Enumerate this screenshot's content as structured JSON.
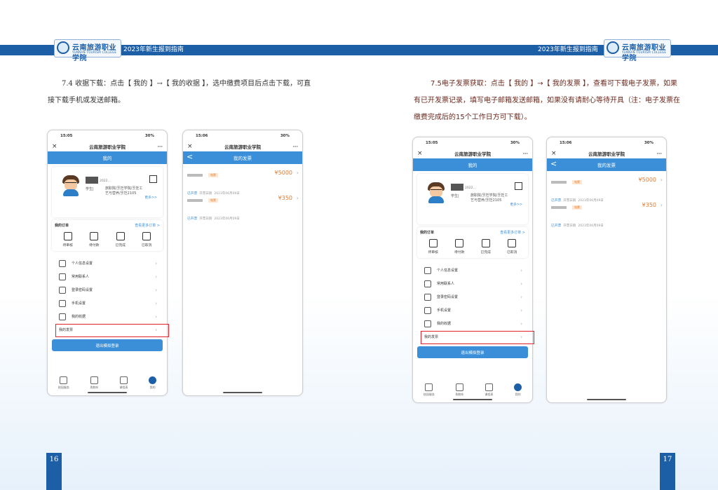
{
  "header": {
    "left_title": "2023年新生报到指南",
    "right_title": "2023年新生报到指南",
    "logo_cn": "云南旅游职业学院",
    "logo_en": "YUNNAN TOURISM COLLEGE"
  },
  "left_page": {
    "instruction": "7.4 收据下载：点击【 我的 】→【 我的收据 】，选中缴费项目后点击下载，可直接下载手机或发送邮箱。",
    "page_number": "16"
  },
  "right_page": {
    "instruction": "7.5电子发票获取：点击【 我的 】→【 我的发票 】，查看可下载电子发票，如果有已开发票记录，填写电子邮箱发送邮箱，如果没有请耐心等待开具（注：电子发票在缴费完成后的15个工作日方可下载）。",
    "page_number": "17"
  },
  "phone_profile": {
    "status_time": "15:05",
    "status_right": "30%",
    "app_title": "云南旅游职业学院",
    "more_dots": "···",
    "close": "×",
    "bar_title": "我的",
    "student_year": "2022...",
    "student_role": "学生|",
    "student_dept": "旅职院/烹饪学院/烹饪工艺与营养/烹饪2105",
    "more_link": "更多>>",
    "orders_title": "我的订单",
    "orders_more": "查看更多订单 >",
    "orders": [
      "待审核",
      "待付款",
      "已完成",
      "已取消"
    ],
    "menu": [
      "个人信息设置",
      "常用联系人",
      "登录密码设置",
      "手机设置",
      "我的收据",
      "我的发票"
    ],
    "logout": "退出模拟登录",
    "tabs": [
      "校园服务",
      "购物车",
      "课程表",
      "我的"
    ]
  },
  "phone_invoice": {
    "status_time": "15:06",
    "status_right": "30%",
    "app_title": "云南旅游职业学院",
    "more_dots": "···",
    "close": "×",
    "bar_title": "我的发票",
    "back": "<",
    "invoices": [
      {
        "tag": "电票",
        "status": "已开票",
        "date_label": "开票日期",
        "date": "2023年06月09日",
        "amount": "¥5000"
      },
      {
        "tag": "电票",
        "status": "已开票",
        "date_label": "开票日期",
        "date": "2023年06月09日",
        "amount": "¥350"
      }
    ]
  }
}
